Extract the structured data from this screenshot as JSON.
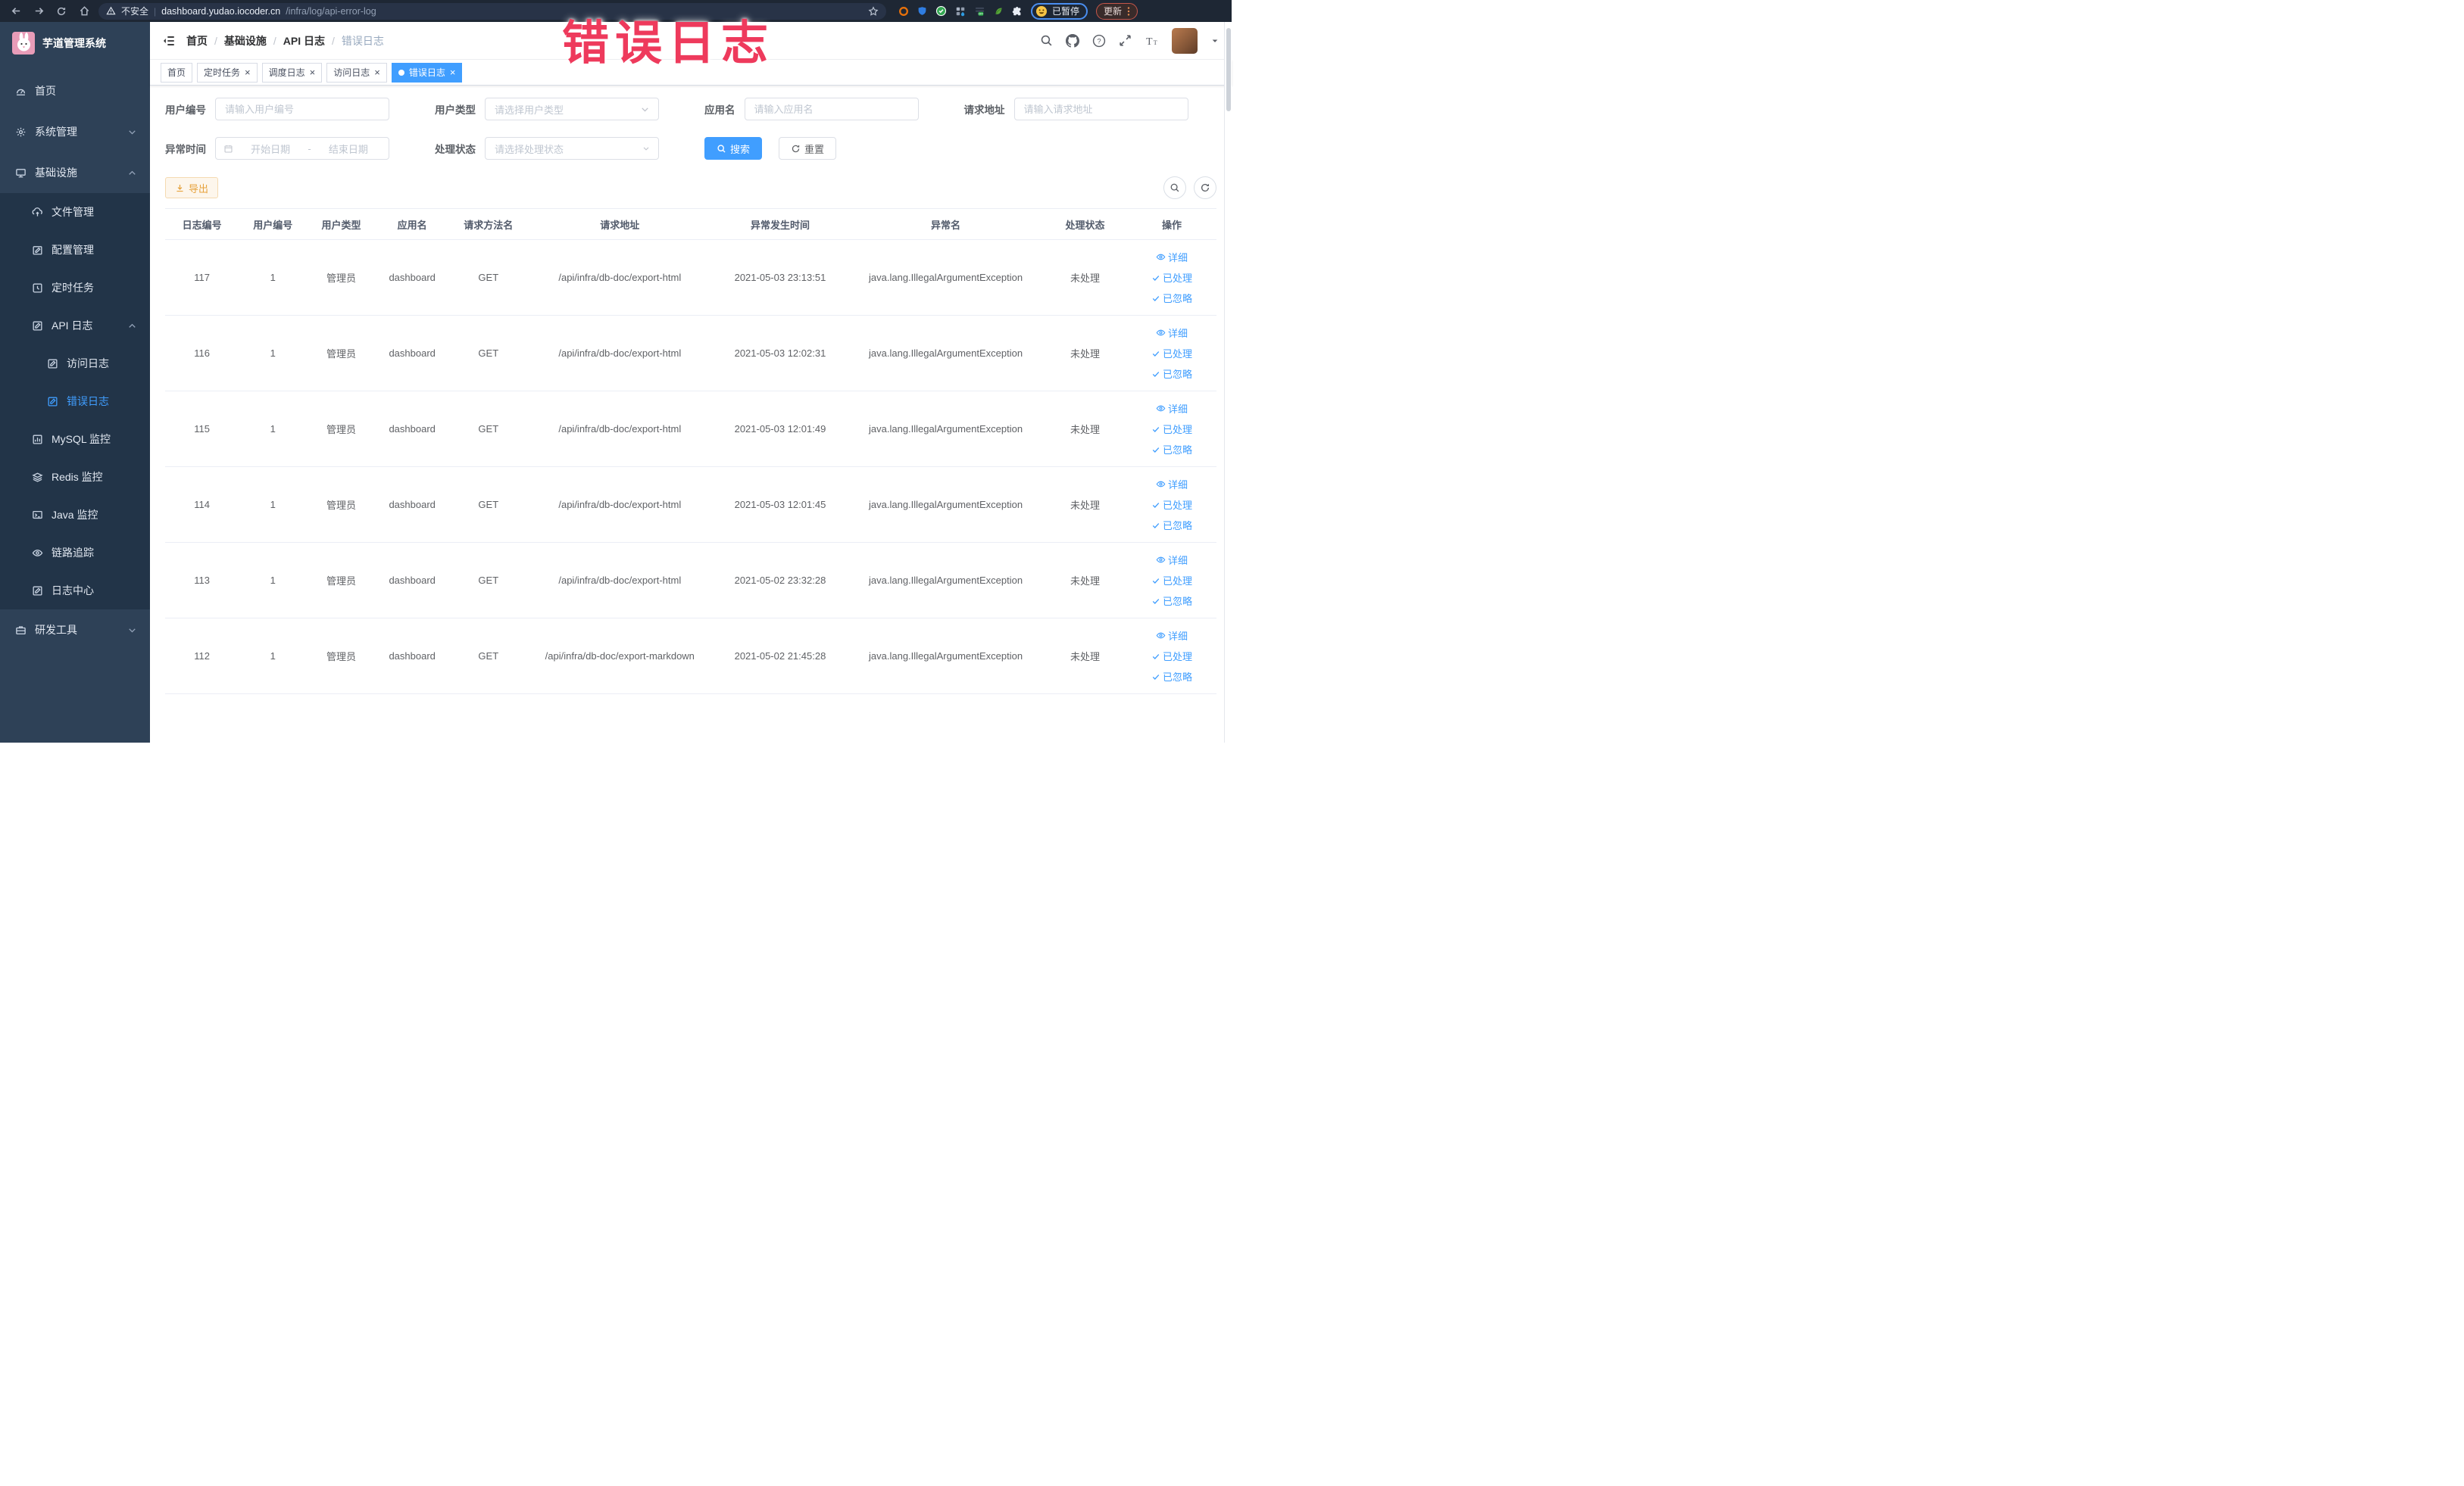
{
  "browser": {
    "security_label": "不安全",
    "url_host": "dashboard.yudao.iocoder.cn",
    "url_path": "/infra/log/api-error-log",
    "profile_badge": "已暂停",
    "update_button": "更新"
  },
  "annotation": {
    "text": "错误日志",
    "color": "#ee3a5c"
  },
  "colors": {
    "accent": "#409eff",
    "warning": "#e6a23c",
    "sidebar_bg": "#2e4157",
    "submenu_bg": "#223448"
  },
  "sidebar": {
    "logo_title": "芋道管理系统",
    "items": [
      {
        "name": "sidebar-item-home",
        "label": "首页",
        "icon": "dashboard-icon",
        "level": 1
      },
      {
        "name": "sidebar-item-system",
        "label": "系统管理",
        "icon": "gear-icon",
        "level": 1,
        "chevron": "down"
      },
      {
        "name": "sidebar-item-infra",
        "label": "基础设施",
        "icon": "monitor-icon",
        "level": 1,
        "chevron": "up"
      },
      {
        "name": "sidebar-item-file",
        "label": "文件管理",
        "icon": "upload-icon",
        "level": 2
      },
      {
        "name": "sidebar-item-config",
        "label": "配置管理",
        "icon": "edit-icon",
        "level": 2
      },
      {
        "name": "sidebar-item-job",
        "label": "定时任务",
        "icon": "clock-icon",
        "level": 2
      },
      {
        "name": "sidebar-item-api-log",
        "label": "API 日志",
        "icon": "log-icon",
        "level": 2,
        "chevron": "up"
      },
      {
        "name": "sidebar-item-access-log",
        "label": "访问日志",
        "icon": "log-icon",
        "level": 3
      },
      {
        "name": "sidebar-item-error-log",
        "label": "错误日志",
        "icon": "log-icon",
        "level": 3,
        "active": true
      },
      {
        "name": "sidebar-item-mysql",
        "label": "MySQL 监控",
        "icon": "chart-icon",
        "level": 2
      },
      {
        "name": "sidebar-item-redis",
        "label": "Redis 监控",
        "icon": "layers-icon",
        "level": 2
      },
      {
        "name": "sidebar-item-java",
        "label": "Java 监控",
        "icon": "java-icon",
        "level": 2
      },
      {
        "name": "sidebar-item-tracing",
        "label": "链路追踪",
        "icon": "eye-icon",
        "level": 2
      },
      {
        "name": "sidebar-item-log-center",
        "label": "日志中心",
        "icon": "log-icon",
        "level": 2
      },
      {
        "name": "sidebar-item-dev-tools",
        "label": "研发工具",
        "icon": "toolbox-icon",
        "level": 1,
        "chevron": "down"
      }
    ]
  },
  "navbar": {
    "breadcrumb": [
      "首页",
      "基础设施",
      "API 日志",
      "错误日志"
    ]
  },
  "tabs": [
    {
      "name": "tab-home",
      "label": "首页",
      "closable": false,
      "active": false
    },
    {
      "name": "tab-job",
      "label": "定时任务",
      "closable": true,
      "active": false
    },
    {
      "name": "tab-job-log",
      "label": "调度日志",
      "closable": true,
      "active": false
    },
    {
      "name": "tab-access-log",
      "label": "访问日志",
      "closable": true,
      "active": false
    },
    {
      "name": "tab-error-log",
      "label": "错误日志",
      "closable": true,
      "active": true
    }
  ],
  "filters": {
    "fields": [
      {
        "name": "user-id-field",
        "label": "用户编号",
        "type": "input",
        "placeholder": "请输入用户编号"
      },
      {
        "name": "user-type-field",
        "label": "用户类型",
        "type": "select",
        "placeholder": "请选择用户类型"
      },
      {
        "name": "app-name-field",
        "label": "应用名",
        "type": "input",
        "placeholder": "请输入应用名"
      },
      {
        "name": "req-url-field",
        "label": "请求地址",
        "type": "input",
        "placeholder": "请输入请求地址"
      }
    ],
    "time_label": "异常时间",
    "start_placeholder": "开始日期",
    "separator": "-",
    "end_placeholder": "结束日期",
    "status_label": "处理状态",
    "status_placeholder": "请选择处理状态",
    "search_button": "搜索",
    "reset_button": "重置"
  },
  "toolbar": {
    "export_button": "导出"
  },
  "table": {
    "columns": [
      "日志编号",
      "用户编号",
      "用户类型",
      "应用名",
      "请求方法名",
      "请求地址",
      "异常发生时间",
      "异常名",
      "处理状态",
      "操作"
    ],
    "actions": [
      "详细",
      "已处理",
      "已忽略"
    ],
    "rows": [
      {
        "id": "117",
        "user_id": "1",
        "user_type": "管理员",
        "app": "dashboard",
        "method": "GET",
        "url": "/api/infra/db-doc/export-html",
        "time": "2021-05-03 23:13:51",
        "exception": "java.lang.IllegalArgumentException",
        "status": "未处理"
      },
      {
        "id": "116",
        "user_id": "1",
        "user_type": "管理员",
        "app": "dashboard",
        "method": "GET",
        "url": "/api/infra/db-doc/export-html",
        "time": "2021-05-03 12:02:31",
        "exception": "java.lang.IllegalArgumentException",
        "status": "未处理"
      },
      {
        "id": "115",
        "user_id": "1",
        "user_type": "管理员",
        "app": "dashboard",
        "method": "GET",
        "url": "/api/infra/db-doc/export-html",
        "time": "2021-05-03 12:01:49",
        "exception": "java.lang.IllegalArgumentException",
        "status": "未处理"
      },
      {
        "id": "114",
        "user_id": "1",
        "user_type": "管理员",
        "app": "dashboard",
        "method": "GET",
        "url": "/api/infra/db-doc/export-html",
        "time": "2021-05-03 12:01:45",
        "exception": "java.lang.IllegalArgumentException",
        "status": "未处理"
      },
      {
        "id": "113",
        "user_id": "1",
        "user_type": "管理员",
        "app": "dashboard",
        "method": "GET",
        "url": "/api/infra/db-doc/export-html",
        "time": "2021-05-02 23:32:28",
        "exception": "java.lang.IllegalArgumentException",
        "status": "未处理"
      },
      {
        "id": "112",
        "user_id": "1",
        "user_type": "管理员",
        "app": "dashboard",
        "method": "GET",
        "url": "/api/infra/db-doc/export-markdown",
        "time": "2021-05-02 21:45:28",
        "exception": "java.lang.IllegalArgumentException",
        "status": "未处理"
      }
    ]
  }
}
